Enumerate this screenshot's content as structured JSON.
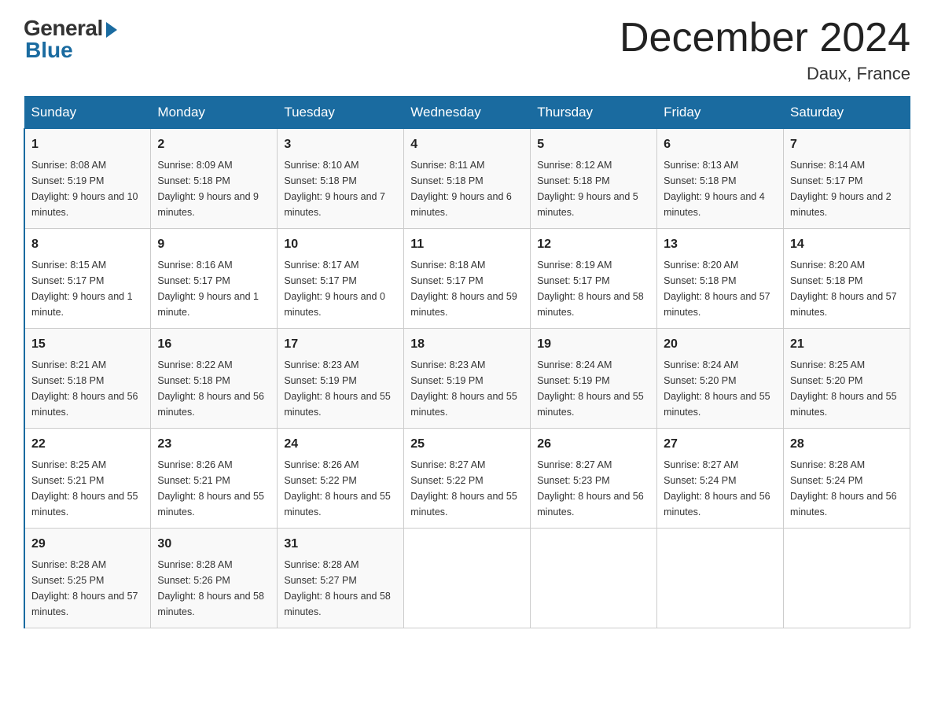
{
  "logo": {
    "general": "General",
    "blue": "Blue"
  },
  "title": "December 2024",
  "subtitle": "Daux, France",
  "days_of_week": [
    "Sunday",
    "Monday",
    "Tuesday",
    "Wednesday",
    "Thursday",
    "Friday",
    "Saturday"
  ],
  "weeks": [
    [
      {
        "day": "1",
        "sunrise": "8:08 AM",
        "sunset": "5:19 PM",
        "daylight": "9 hours and 10 minutes."
      },
      {
        "day": "2",
        "sunrise": "8:09 AM",
        "sunset": "5:18 PM",
        "daylight": "9 hours and 9 minutes."
      },
      {
        "day": "3",
        "sunrise": "8:10 AM",
        "sunset": "5:18 PM",
        "daylight": "9 hours and 7 minutes."
      },
      {
        "day": "4",
        "sunrise": "8:11 AM",
        "sunset": "5:18 PM",
        "daylight": "9 hours and 6 minutes."
      },
      {
        "day": "5",
        "sunrise": "8:12 AM",
        "sunset": "5:18 PM",
        "daylight": "9 hours and 5 minutes."
      },
      {
        "day": "6",
        "sunrise": "8:13 AM",
        "sunset": "5:18 PM",
        "daylight": "9 hours and 4 minutes."
      },
      {
        "day": "7",
        "sunrise": "8:14 AM",
        "sunset": "5:17 PM",
        "daylight": "9 hours and 2 minutes."
      }
    ],
    [
      {
        "day": "8",
        "sunrise": "8:15 AM",
        "sunset": "5:17 PM",
        "daylight": "9 hours and 1 minute."
      },
      {
        "day": "9",
        "sunrise": "8:16 AM",
        "sunset": "5:17 PM",
        "daylight": "9 hours and 1 minute."
      },
      {
        "day": "10",
        "sunrise": "8:17 AM",
        "sunset": "5:17 PM",
        "daylight": "9 hours and 0 minutes."
      },
      {
        "day": "11",
        "sunrise": "8:18 AM",
        "sunset": "5:17 PM",
        "daylight": "8 hours and 59 minutes."
      },
      {
        "day": "12",
        "sunrise": "8:19 AM",
        "sunset": "5:17 PM",
        "daylight": "8 hours and 58 minutes."
      },
      {
        "day": "13",
        "sunrise": "8:20 AM",
        "sunset": "5:18 PM",
        "daylight": "8 hours and 57 minutes."
      },
      {
        "day": "14",
        "sunrise": "8:20 AM",
        "sunset": "5:18 PM",
        "daylight": "8 hours and 57 minutes."
      }
    ],
    [
      {
        "day": "15",
        "sunrise": "8:21 AM",
        "sunset": "5:18 PM",
        "daylight": "8 hours and 56 minutes."
      },
      {
        "day": "16",
        "sunrise": "8:22 AM",
        "sunset": "5:18 PM",
        "daylight": "8 hours and 56 minutes."
      },
      {
        "day": "17",
        "sunrise": "8:23 AM",
        "sunset": "5:19 PM",
        "daylight": "8 hours and 55 minutes."
      },
      {
        "day": "18",
        "sunrise": "8:23 AM",
        "sunset": "5:19 PM",
        "daylight": "8 hours and 55 minutes."
      },
      {
        "day": "19",
        "sunrise": "8:24 AM",
        "sunset": "5:19 PM",
        "daylight": "8 hours and 55 minutes."
      },
      {
        "day": "20",
        "sunrise": "8:24 AM",
        "sunset": "5:20 PM",
        "daylight": "8 hours and 55 minutes."
      },
      {
        "day": "21",
        "sunrise": "8:25 AM",
        "sunset": "5:20 PM",
        "daylight": "8 hours and 55 minutes."
      }
    ],
    [
      {
        "day": "22",
        "sunrise": "8:25 AM",
        "sunset": "5:21 PM",
        "daylight": "8 hours and 55 minutes."
      },
      {
        "day": "23",
        "sunrise": "8:26 AM",
        "sunset": "5:21 PM",
        "daylight": "8 hours and 55 minutes."
      },
      {
        "day": "24",
        "sunrise": "8:26 AM",
        "sunset": "5:22 PM",
        "daylight": "8 hours and 55 minutes."
      },
      {
        "day": "25",
        "sunrise": "8:27 AM",
        "sunset": "5:22 PM",
        "daylight": "8 hours and 55 minutes."
      },
      {
        "day": "26",
        "sunrise": "8:27 AM",
        "sunset": "5:23 PM",
        "daylight": "8 hours and 56 minutes."
      },
      {
        "day": "27",
        "sunrise": "8:27 AM",
        "sunset": "5:24 PM",
        "daylight": "8 hours and 56 minutes."
      },
      {
        "day": "28",
        "sunrise": "8:28 AM",
        "sunset": "5:24 PM",
        "daylight": "8 hours and 56 minutes."
      }
    ],
    [
      {
        "day": "29",
        "sunrise": "8:28 AM",
        "sunset": "5:25 PM",
        "daylight": "8 hours and 57 minutes."
      },
      {
        "day": "30",
        "sunrise": "8:28 AM",
        "sunset": "5:26 PM",
        "daylight": "8 hours and 58 minutes."
      },
      {
        "day": "31",
        "sunrise": "8:28 AM",
        "sunset": "5:27 PM",
        "daylight": "8 hours and 58 minutes."
      },
      null,
      null,
      null,
      null
    ]
  ]
}
